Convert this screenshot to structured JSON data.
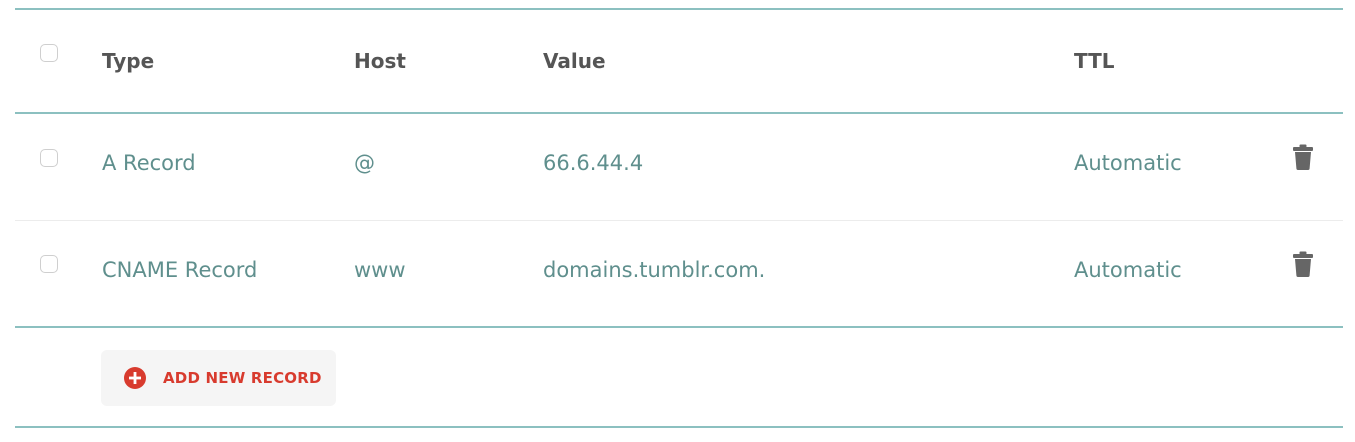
{
  "table": {
    "headers": {
      "type": "Type",
      "host": "Host",
      "value": "Value",
      "ttl": "TTL"
    },
    "records": [
      {
        "type": "A Record",
        "host": "@",
        "value": "66.6.44.4",
        "ttl": "Automatic",
        "delete_icon": "trash-icon"
      },
      {
        "type": "CNAME Record",
        "host": "www",
        "value": "domains.tumblr.com.",
        "ttl": "Automatic",
        "delete_icon": "trash-icon"
      }
    ]
  },
  "actions": {
    "add_record_label": "ADD NEW RECORD",
    "add_record_icon": "plus-circle-icon"
  },
  "colors": {
    "accent_red": "#d83b2e",
    "rule_teal": "#8cc0c0",
    "cell_text": "#5f8f8d",
    "header_text": "#555555"
  }
}
